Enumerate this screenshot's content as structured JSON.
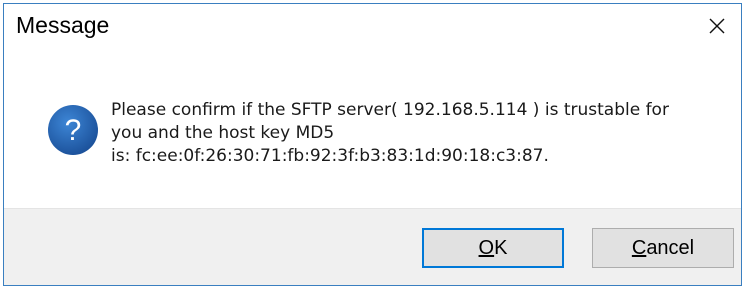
{
  "window": {
    "title": "Message",
    "close_icon": "close-icon"
  },
  "message": {
    "icon": "question-icon",
    "icon_color": "#1f5fa8",
    "line1": "Please confirm if the SFTP server( 192.168.5.114 ) is trustable for",
    "line2": "you and the host key MD5",
    "line3": "is: fc:ee:0f:26:30:71:fb:92:3f:b3:83:1d:90:18:c3:87."
  },
  "buttons": {
    "ok": {
      "mnemonic": "O",
      "rest": "K"
    },
    "cancel": {
      "mnemonic": "C",
      "rest": "ancel"
    },
    "default_border_color": "#0078d7"
  }
}
